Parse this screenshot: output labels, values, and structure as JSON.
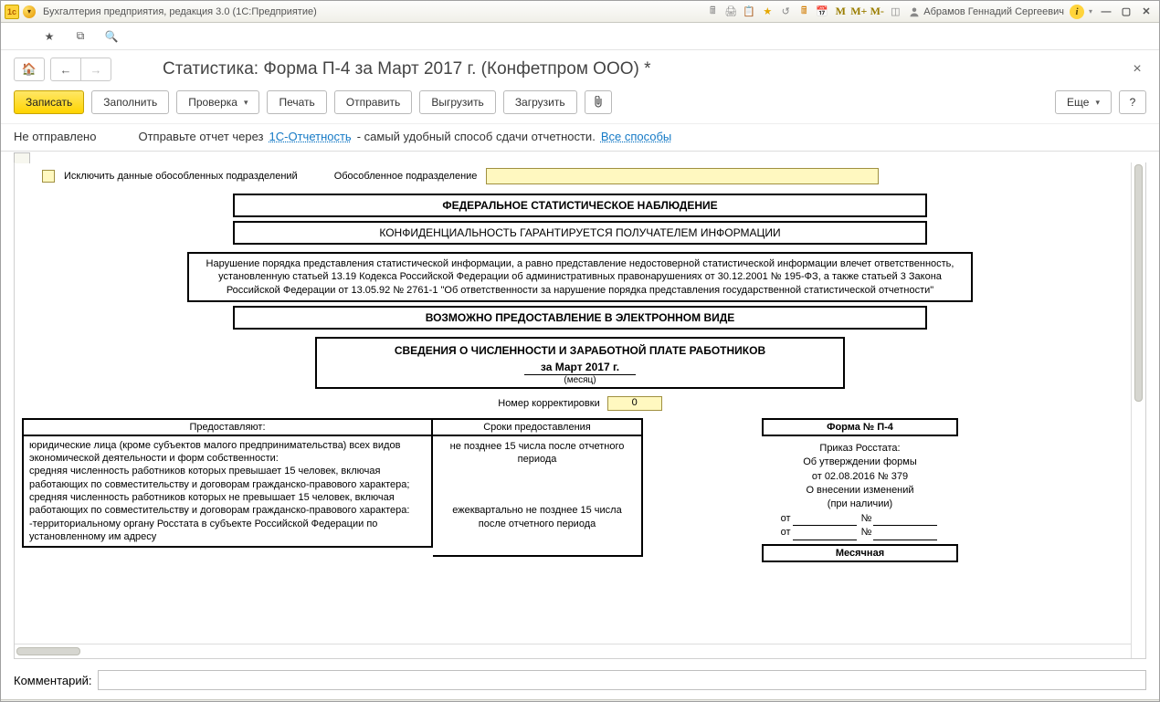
{
  "window": {
    "app_title": "Бухгалтерия предприятия, редакция 3.0  (1С:Предприятие)",
    "user_name": "Абрамов Геннадий Сергеевич"
  },
  "page": {
    "title": "Статистика: Форма П-4 за Март 2017 г. (Конфетпром ООО) *"
  },
  "toolbar": {
    "write": "Записать",
    "fill": "Заполнить",
    "check": "Проверка",
    "print": "Печать",
    "send": "Отправить",
    "export": "Выгрузить",
    "import": "Загрузить",
    "more": "Еще",
    "help": "?"
  },
  "status": {
    "label": "Не отправлено",
    "hint_pre": "Отправьте отчет через ",
    "hint_link": "1С-Отчетность",
    "hint_post": " - самый удобный способ сдачи отчетности. ",
    "hint_all": "Все способы"
  },
  "options": {
    "exclude_label": "Исключить данные обособленных подразделений",
    "subdiv_label": "Обособленное подразделение",
    "subdiv_value": ""
  },
  "report": {
    "line1": "ФЕДЕРАЛЬНОЕ СТАТИСТИЧЕСКОЕ НАБЛЮДЕНИЕ",
    "line2": "КОНФИДЕНЦИАЛЬНОСТЬ ГАРАНТИРУЕТСЯ ПОЛУЧАТЕЛЕМ ИНФОРМАЦИИ",
    "legal": "Нарушение порядка представления статистической информации, а равно представление недостоверной статистической информации влечет ответственность, установленную статьей 13.19 Кодекса Российской Федерации об административных правонарушениях от 30.12.2001 № 195-ФЗ, а также статьей 3 Закона Российской Федерации от 13.05.92 № 2761-1 \"Об ответственности за нарушение порядка представления государственной статистической отчетности\"",
    "line4": "ВОЗМОЖНО ПРЕДОСТАВЛЕНИЕ В ЭЛЕКТРОННОМ ВИДЕ",
    "period_title": "СВЕДЕНИЯ О ЧИСЛЕННОСТИ И ЗАРАБОТНОЙ ПЛАТЕ РАБОТНИКОВ",
    "period_value": "за Март 2017 г.",
    "period_sub": "(месяц)",
    "corr_label": "Номер корректировки",
    "corr_value": "0",
    "th_left": "Предоставляют:",
    "th_mid": "Сроки предоставления",
    "td_left": "юридические лица (кроме субъектов малого предпринимательства) всех видов экономической деятельности и форм собственности:\n средняя численность работников которых превышает 15 человек, включая работающих по совместительству и договорам гражданско-правового характера;\nсредняя численность работников которых не превышает 15 человек, включая работающих по совместительству и договорам гражданско-правового характера:\n  -территориальному органу Росстата в субъекте Российской Федерации по установленному им адресу",
    "td_mid_1": "не позднее 15 числа после отчетного периода",
    "td_mid_2": "ежеквартально не позднее 15 числа после отчетного периода",
    "form_no_label": "Форма № П-4",
    "order_l1": "Приказ Росстата:",
    "order_l2": "Об утверждении формы",
    "order_l3": "от 02.08.2016 № 379",
    "order_l4": "О внесении изменений",
    "order_l5": "(при наличии)",
    "ot": "от",
    "no": "№",
    "monthly": "Месячная"
  },
  "footer": {
    "comment_label": "Комментарий:"
  }
}
